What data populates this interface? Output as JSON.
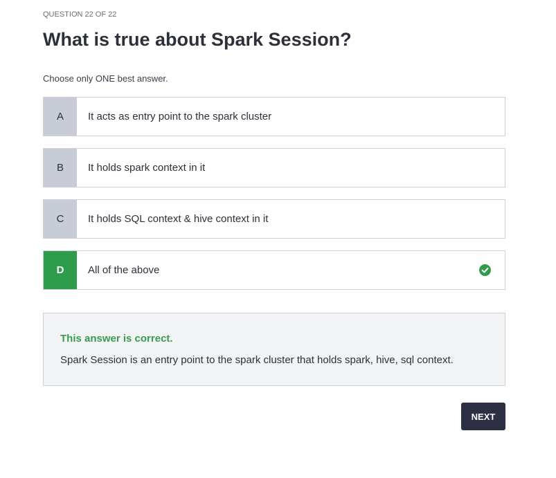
{
  "header": {
    "question_counter": "QUESTION 22 OF 22",
    "title": "What is true about Spark Session?",
    "instruction": "Choose only ONE best answer."
  },
  "options": [
    {
      "letter": "A",
      "text": "It acts as entry point to the spark cluster",
      "selected": false
    },
    {
      "letter": "B",
      "text": "It holds spark context in it",
      "selected": false
    },
    {
      "letter": "C",
      "text": "It holds SQL context & hive context in it",
      "selected": false
    },
    {
      "letter": "D",
      "text": "All of the above",
      "selected": true,
      "status_icon": "check-circle-icon"
    }
  ],
  "feedback": {
    "title": "This answer is correct.",
    "explanation": "Spark Session is an entry point to the spark cluster that holds spark, hive, sql context."
  },
  "footer": {
    "next_label": "NEXT"
  },
  "colors": {
    "correct": "#2f9c4b",
    "letter_bg": "#c8ccd6",
    "button_bg": "#2d2f45"
  }
}
